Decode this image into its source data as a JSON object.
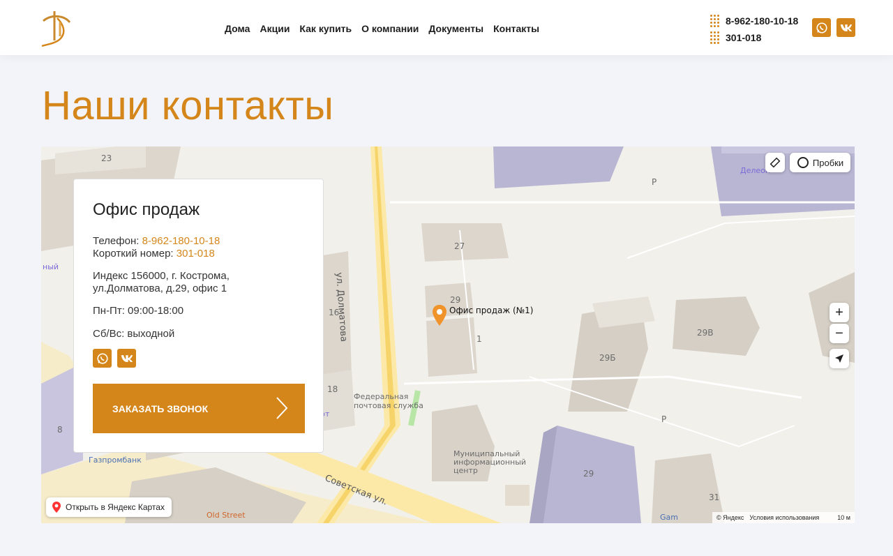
{
  "header": {
    "nav": [
      "Дома",
      "Акции",
      "Как купить",
      "О компании",
      "Документы",
      "Контакты"
    ],
    "phones": [
      "8-962-180-10-18",
      "301-018"
    ],
    "social": [
      "whatsapp-icon",
      "vk-icon"
    ],
    "accent_color": "#d4861a"
  },
  "page": {
    "title": "Наши контакты"
  },
  "card": {
    "title": "Офис продаж",
    "phone_label": "Телефон:",
    "phone_value": "8-962-180-10-18",
    "short_label": "Короткий номер:",
    "short_value": "301-018",
    "address_line1": "Индекс 156000, г. Кострома,",
    "address_line2": "ул.Долматова, д.29, офис 1",
    "hours_weekday": "Пн-Пт: 09:00-18:00",
    "hours_weekend": "Сб/Вс: выходной",
    "call_button": "ЗАКАЗАТЬ ЗВОНОК"
  },
  "map": {
    "traffic_button": "Пробки",
    "zoom_in": "+",
    "zoom_out": "−",
    "open_in_yandex": "Открыть в Яндекс Картах",
    "copyright": "© Яндекс",
    "terms": "Условия использования",
    "scale": "10 м",
    "placemark_label": "Офис продаж (№1)",
    "streets": {
      "dolmatova": "ул. Долматова",
      "sovetskaya": "Советская ул."
    },
    "labels": {
      "b23": "23",
      "b27": "27",
      "b29": "29",
      "b16": "16",
      "b18": "18",
      "b1": "1",
      "b29b": "29Б",
      "b29v": "29В",
      "b29m": "29",
      "b31": "31",
      "b8": "8",
      "delta": "Делеон",
      "post1": "Федеральная",
      "post2": "почтовая служба",
      "mun1": "Муниципальный",
      "mun2": "информационный",
      "mun3": "центр",
      "gazprom": "Газпромбанк",
      "oldstreet": "Old Street",
      "p1": "P",
      "p2": "P",
      "gam": "Gam",
      "vr": "рт",
      "ny": "ный"
    }
  }
}
